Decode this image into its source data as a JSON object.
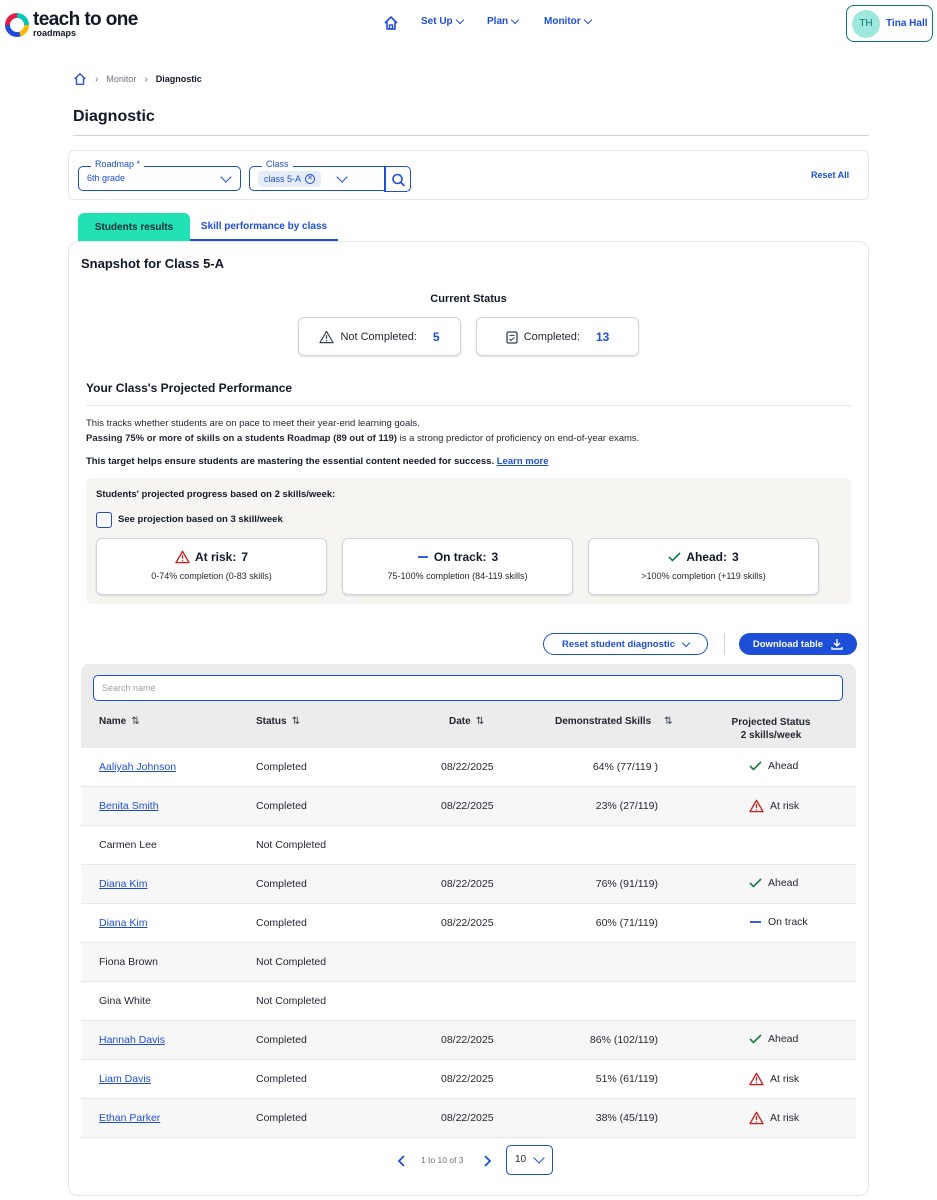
{
  "header": {
    "logo_main": "teach to one",
    "logo_sub": "roadmaps",
    "nav": [
      {
        "label": "Set Up"
      },
      {
        "label": "Plan"
      },
      {
        "label": "Monitor"
      }
    ],
    "user": {
      "initials": "TH",
      "name": "Tina Hall"
    }
  },
  "breadcrumb": {
    "monitor": "Monitor",
    "current": "Diagnostic"
  },
  "page_title": "Diagnostic",
  "filters": {
    "roadmap_label": "Roadmap *",
    "roadmap_value": "6th grade",
    "class_label": "Class",
    "class_chip": "class 5-A",
    "reset_all": "Reset All"
  },
  "tabs": {
    "students_results": "Students results",
    "skill_performance": "Skill performance by class"
  },
  "snapshot_title": "Snapshot for Class 5-A",
  "current_status": {
    "heading": "Current Status",
    "not_completed_label": "Not Completed:",
    "not_completed_value": "5",
    "completed_label": "Completed:",
    "completed_value": "13"
  },
  "projected": {
    "title": "Your Class's Projected Performance",
    "desc1": "This tracks whether students are on pace to meet their year-end learning goals.",
    "desc2_bold": "Passing 75% or more of skills on a students Roadmap (89 out of 119)",
    "desc2_rest": " is a strong predictor of proficiency on end-of-year exams.",
    "desc3": "This target helps ensure students are mastering the essential content needed for success.",
    "learn_more": "Learn more",
    "progress_label": "Students' projected progress based on 2 skills/week:",
    "checkbox_label": "See projection based on 3 skill/week",
    "buckets": [
      {
        "label": "At risk:",
        "count": "7",
        "sub": "0-74% completion (0-83 skills)"
      },
      {
        "label": "On track:",
        "count": "3",
        "sub": "75-100% completion (84-119 skills)"
      },
      {
        "label": "Ahead:",
        "count": "3",
        "sub": ">100% completion (+119 skills)"
      }
    ]
  },
  "actions": {
    "reset_diagnostic": "Reset student diagnostic",
    "download_table": "Download table"
  },
  "table": {
    "search_placeholder": "Search name",
    "columns": {
      "name": "Name",
      "status": "Status",
      "date": "Date",
      "skills": "Demonstrated Skills",
      "projected_1": "Projected Status",
      "projected_2": "2 skills/week"
    },
    "rows": [
      {
        "name": "Aaliyah Johnson",
        "status": "Completed",
        "date": "08/22/2025",
        "skills": "64% (77/119 )",
        "projected": "Ahead"
      },
      {
        "name": "Benita Smith",
        "status": "Completed",
        "date": "08/22/2025",
        "skills": "23% (27/119)",
        "projected": "At risk"
      },
      {
        "name": "Carmen Lee",
        "status": "Not Completed",
        "date": "",
        "skills": "",
        "projected": ""
      },
      {
        "name": "Diana Kim",
        "status": "Completed",
        "date": "08/22/2025",
        "skills": "76% (91/119)",
        "projected": "Ahead"
      },
      {
        "name": "Diana Kim",
        "status": "Completed",
        "date": "08/22/2025",
        "skills": "60% (71/119)",
        "projected": "On track"
      },
      {
        "name": "Fiona Brown",
        "status": "Not Completed",
        "date": "",
        "skills": "",
        "projected": ""
      },
      {
        "name": "Gina White",
        "status": "Not Completed",
        "date": "",
        "skills": "",
        "projected": ""
      },
      {
        "name": "Hannah Davis",
        "status": "Completed",
        "date": "08/22/2025",
        "skills": "86% (102/119)",
        "projected": "Ahead"
      },
      {
        "name": "Liam Davis",
        "status": "Completed",
        "date": "08/22/2025",
        "skills": "51% (61/119)",
        "projected": "At risk"
      },
      {
        "name": "Ethan Parker",
        "status": "Completed",
        "date": "08/22/2025",
        "skills": "38% (45/119)",
        "projected": "At risk"
      }
    ]
  },
  "pagination": {
    "text": "1 to 10 of 3",
    "per_page": "10"
  },
  "colors": {
    "accent": "#1d4ed8",
    "tab_active": "#22e1b5",
    "risk": "#c81e1e",
    "ahead": "#15803d"
  }
}
